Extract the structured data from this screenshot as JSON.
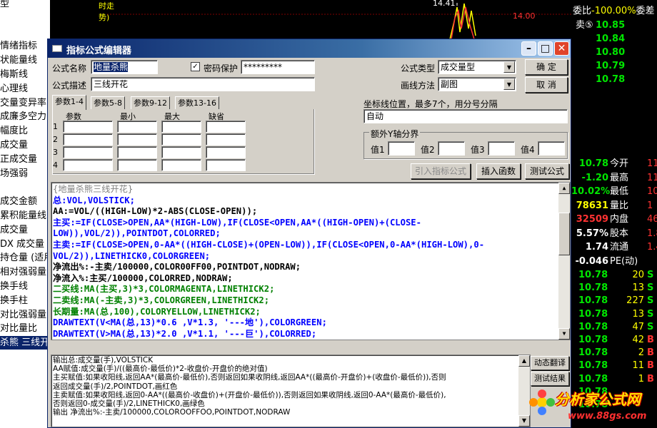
{
  "background_app": {
    "left_list": [
      "型",
      "",
      "",
      "情绪指标",
      "状能量线",
      "梅斯线",
      "心理线",
      "交量变异率",
      "成廉多空力",
      "幅度比",
      "成交量",
      "正成交量",
      "场强弱",
      "",
      "成交金额",
      "累积能量线",
      "成交量",
      "DX 成交量",
      "持仓量 (适用",
      "相对强弱量",
      "换手线",
      "换手柱",
      "对比强弱量",
      "对比量比",
      "杀熊 三线开"
    ],
    "left_selected_index": 24,
    "chart_top_labels": [
      "时走",
      "势)",
      "14.41",
      "14.00"
    ],
    "right_header": {
      "label1": "委比",
      "value1": "-100.00%",
      "label2": "委差"
    },
    "order_rows": [
      {
        "label": "卖⑤",
        "price": "10.85"
      },
      {
        "label": "",
        "price": "10.84"
      },
      {
        "label": "",
        "price": "10.80"
      },
      {
        "label": "",
        "price": "10.79"
      },
      {
        "label": "",
        "price": "10.78"
      }
    ],
    "stats": [
      {
        "value": "10.78",
        "label": "今开",
        "extra": "11"
      },
      {
        "value": "-1.20",
        "label": "最高",
        "extra": "11"
      },
      {
        "value": "10.02%",
        "label": "最低",
        "extra": "10"
      },
      {
        "value": "78631",
        "label": "量比",
        "extra": "1"
      },
      {
        "value": "32509",
        "label": "内盘",
        "extra": "46"
      },
      {
        "value": "5.57%",
        "label": "股本",
        "extra": "1.8"
      },
      {
        "value": "1.74",
        "label": "流通",
        "extra": "1.4"
      },
      {
        "value": "-0.046",
        "label": "PE(动)",
        "extra": ""
      }
    ],
    "ticks": [
      {
        "price": "10.78",
        "vol": "20",
        "side": "S"
      },
      {
        "price": "10.78",
        "vol": "13",
        "side": "S"
      },
      {
        "price": "10.78",
        "vol": "227",
        "side": "S"
      },
      {
        "price": "10.78",
        "vol": "13",
        "side": "S"
      },
      {
        "price": "10.78",
        "vol": "47",
        "side": "S"
      },
      {
        "price": "10.78",
        "vol": "42",
        "side": "B"
      },
      {
        "price": "10.78",
        "vol": "2",
        "side": "B"
      },
      {
        "price": "10.78",
        "vol": "11",
        "side": "B"
      },
      {
        "price": "10.78",
        "vol": "1",
        "side": "B"
      },
      {
        "price": "10.78",
        "vol": "",
        "side": ""
      },
      {
        "price": "10.78",
        "vol": "",
        "side": ""
      }
    ]
  },
  "dialog": {
    "title": "指标公式编辑器",
    "name_label": "公式名称",
    "name_value": "地量杀熊",
    "password_label": "密码保护",
    "password_checked": "✓",
    "password_value": "*********",
    "type_label": "公式类型",
    "type_value": "成交量型",
    "ok_label": "确  定",
    "desc_label": "公式描述",
    "desc_value": "三线开花",
    "draw_label": "画线方法",
    "draw_value": "副图",
    "cancel_label": "取  消",
    "tabs": [
      "参数1-4",
      "参数5-8",
      "参数9-12",
      "参数13-16"
    ],
    "param_headers": [
      "参数",
      "最小",
      "最大",
      "缺省"
    ],
    "param_rows": [
      "1",
      "2",
      "3",
      "4"
    ],
    "coord_label": "坐标线位置，最多7个，用分号分隔",
    "coord_value": "自动",
    "yaxis_label": "额外Y轴分界",
    "yaxis_values": [
      "值1",
      "值2",
      "值3",
      "值4"
    ],
    "import_button": "引入指标公式",
    "insert_button": "插入函数",
    "test_button": "测试公式",
    "translate_button": "动态翻译",
    "result_button": "测试结果"
  },
  "code_lines": [
    {
      "text": "{地量杀熊三线开花}",
      "color": "#808080"
    },
    {
      "text": "总:VOL,VOLSTICK;",
      "color": "#0000ff"
    },
    {
      "text": "AA:=VOL/((HIGH-LOW)*2-ABS(CLOSE-OPEN));",
      "color": "#000000"
    },
    {
      "text": "主买:=IF(CLOSE>OPEN,AA*(HIGH-LOW),IF(CLOSE<OPEN,AA*((HIGH-OPEN)+(CLOSE-",
      "color": "#0000ff"
    },
    {
      "text": "LOW)),VOL/2)),POINTDOT,COLORRED;",
      "color": "#0000ff"
    },
    {
      "text": "主卖:=IF(CLOSE>OPEN,0-AA*((HIGH-CLOSE)+(OPEN-LOW)),IF(CLOSE<OPEN,0-AA*(HIGH-LOW),0-",
      "color": "#0000ff"
    },
    {
      "text": "VOL/2)),LINETHICK0,COLORGREEN;",
      "color": "#0000ff"
    },
    {
      "text": "净流出%:-主卖/100000,COLOR00FF00,POINTDOT,NODRAW;",
      "color": "#000000"
    },
    {
      "text": "净流入%:主买/100000,COLORRED,NODRAW;",
      "color": "#000000"
    },
    {
      "text": "二买线:MA(主买,3)*3,COLORMAGENTA,LINETHICK2;",
      "color": "#008000"
    },
    {
      "text": "二卖线:MA(-主卖,3)*3,COLORGREEN,LINETHICK2;",
      "color": "#008000"
    },
    {
      "text": "长期量:MA(总,100),COLORYELLOW,LINETHICK2;",
      "color": "#008000"
    },
    {
      "text": "DRAWTEXT(V<MA(总,13)*0.6 ,V*1.3, '---地'),COLORGREEN;",
      "color": "#0000ff"
    },
    {
      "text": "DRAWTEXT(V>MA(总,13)*2.0 ,V*1.1, '---巨'),COLORRED;",
      "color": "#0000ff"
    }
  ],
  "output_lines": [
    "输出总:成交量(手),VOLSTICK",
    "AA赋值:成交量(手)/((最高价-最低价)*2-收盘价-开盘价的绝对值)",
    "主买赋值:如果收阳线,返回AA*(最高价-最低价),否则返回如果收阴线,返回AA*((最高价-开盘价)+(收盘价-最低价)),否则",
    "返回成交量(手)/2,POINTDOT,画红色",
    "主卖赋值:如果收阳线,返回0-AA*((最高价-收盘价)+(开盘价-最低价)),否则返回如果收阴线,返回0-AA*(最高价-最低价),",
    "否则返回0-成交量(手)/2,LINETHICK0,画绿色",
    "输出 净流出%:-主卖/100000,COLOROOFFOO,POINTDOT,NODRAW"
  ],
  "watermark": {
    "text": "分析家公式网",
    "url": "www.88gs.com"
  },
  "colors": {
    "title_bar": "#0a246a",
    "dialog_bg": "#d4d0c8",
    "price_yellow": "#ffff00",
    "price_green": "#00e600",
    "price_red": "#ff3232"
  }
}
